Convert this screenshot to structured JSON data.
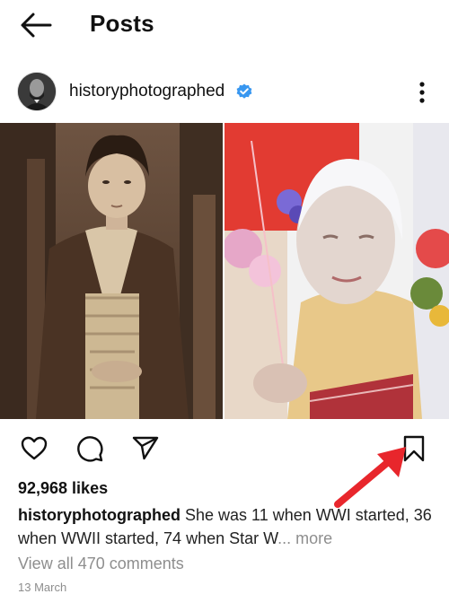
{
  "header": {
    "title": "Posts",
    "back_icon": "arrow-left-icon"
  },
  "post": {
    "username": "historyphotographed",
    "verified_icon": "verified-badge-icon",
    "likes": "92,968 likes",
    "caption_user": "historyphotographed",
    "caption_text": " She was 11 when WWI started, 36 when WWII started, 74 when Star W",
    "caption_more": "... more",
    "comments_link": "View all 470 comments",
    "date": "13 March"
  },
  "actions": {
    "like_icon": "heart-icon",
    "comment_icon": "comment-icon",
    "share_icon": "send-icon",
    "save_icon": "bookmark-icon"
  },
  "colors": {
    "verified": "#3897f0",
    "annotation_arrow": "#e8262c",
    "muted_text": "#8e8e8e"
  }
}
